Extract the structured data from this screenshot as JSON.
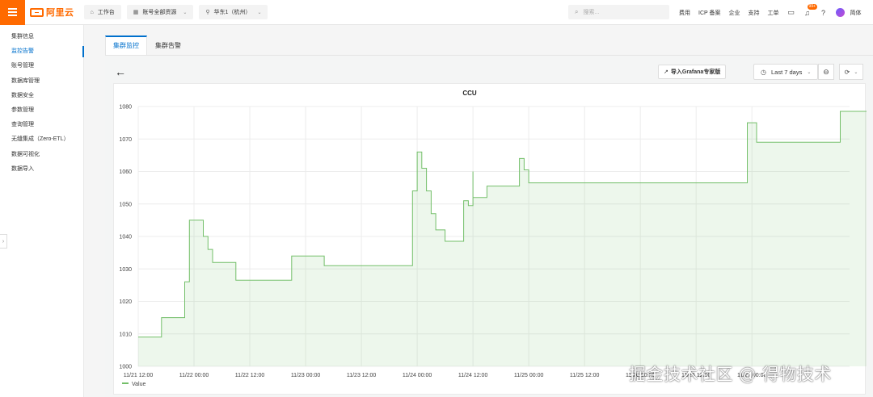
{
  "topbar": {
    "logo_text": "阿里云",
    "workbench": "工作台",
    "account": "账号全部资源",
    "region": "华东1（杭州）",
    "search_placeholder": "搜索...",
    "nav": [
      "费用",
      "ICP 备案",
      "企业",
      "支持",
      "工单"
    ],
    "badge": "99+",
    "lang": "简体",
    "accent_color": "#ff6a00"
  },
  "sidebar": {
    "items": [
      {
        "label": "集群信息"
      },
      {
        "label": "监控告警"
      },
      {
        "label": "账号管理"
      },
      {
        "label": "数据库管理"
      },
      {
        "label": "数据安全"
      },
      {
        "label": "参数管理"
      },
      {
        "label": "查询管理"
      },
      {
        "label": "无缝集成（Zero-ETL）"
      },
      {
        "label": "数据可视化"
      },
      {
        "label": "数据导入"
      }
    ],
    "active_index": 1
  },
  "tabs": [
    {
      "label": "集群监控",
      "active": true
    },
    {
      "label": "集群告警",
      "active": false
    }
  ],
  "toolbar": {
    "grafana_label": "导入Grafana专家版",
    "time_range": "Last 7 days"
  },
  "chart_data": {
    "type": "area",
    "title": "CCU",
    "xlabel": "",
    "ylabel": "",
    "ylim": [
      1000,
      1080
    ],
    "yticks": [
      1000,
      1010,
      1020,
      1030,
      1040,
      1050,
      1060,
      1070,
      1080
    ],
    "x_range": [
      "2024-11-21 12:00",
      "2024-11-27 21:00"
    ],
    "xticks": [
      "11/21 12:00",
      "11/22 00:00",
      "11/22 12:00",
      "11/23 00:00",
      "11/23 12:00",
      "11/24 00:00",
      "11/24 12:00",
      "11/25 00:00",
      "11/25 12:00",
      "11/26 00:00",
      "11/26 12:00",
      "11/27 00:00"
    ],
    "grid": true,
    "legend": "bottom-left",
    "color": "#73bf69",
    "series": [
      {
        "name": "Value",
        "points": [
          [
            "11/21 12:00",
            1009
          ],
          [
            "11/21 17:00",
            1009
          ],
          [
            "11/21 17:00",
            1015
          ],
          [
            "11/21 22:00",
            1015
          ],
          [
            "11/21 22:00",
            1026
          ],
          [
            "11/21 23:00",
            1026
          ],
          [
            "11/21 23:00",
            1045
          ],
          [
            "11/22 02:00",
            1045
          ],
          [
            "11/22 02:00",
            1040
          ],
          [
            "11/22 03:00",
            1040
          ],
          [
            "11/22 03:00",
            1036
          ],
          [
            "11/22 04:00",
            1036
          ],
          [
            "11/22 04:00",
            1032
          ],
          [
            "11/22 09:00",
            1032
          ],
          [
            "11/22 09:00",
            1026.5
          ],
          [
            "11/22 21:00",
            1026.5
          ],
          [
            "11/22 21:00",
            1034
          ],
          [
            "11/23 04:00",
            1034
          ],
          [
            "11/23 04:00",
            1031
          ],
          [
            "11/23 23:00",
            1031
          ],
          [
            "11/23 23:00",
            1054
          ],
          [
            "11/24 00:00",
            1054
          ],
          [
            "11/24 00:00",
            1066
          ],
          [
            "11/24 01:00",
            1066
          ],
          [
            "11/24 01:00",
            1061
          ],
          [
            "11/24 02:00",
            1061
          ],
          [
            "11/24 02:00",
            1054
          ],
          [
            "11/24 03:00",
            1054
          ],
          [
            "11/24 03:00",
            1047
          ],
          [
            "11/24 04:00",
            1047
          ],
          [
            "11/24 04:00",
            1042
          ],
          [
            "11/24 06:00",
            1042
          ],
          [
            "11/24 06:00",
            1038.5
          ],
          [
            "11/24 10:00",
            1038.5
          ],
          [
            "11/24 10:00",
            1051
          ],
          [
            "11/24 11:00",
            1051
          ],
          [
            "11/24 11:00",
            1049.5
          ],
          [
            "11/24 12:00",
            1049.5
          ],
          [
            "11/24 12:00",
            1060
          ],
          [
            "11/24 12:00",
            1052
          ],
          [
            "11/24 15:00",
            1052
          ],
          [
            "11/24 15:00",
            1055.5
          ],
          [
            "11/24 22:00",
            1055.5
          ],
          [
            "11/24 22:00",
            1064
          ],
          [
            "11/24 23:00",
            1064
          ],
          [
            "11/24 23:00",
            1060.5
          ],
          [
            "11/25 00:00",
            1060.5
          ],
          [
            "11/25 00:00",
            1056.5
          ],
          [
            "11/26 23:00",
            1056.5
          ],
          [
            "11/26 23:00",
            1075
          ],
          [
            "11/27 01:00",
            1075
          ],
          [
            "11/27 01:00",
            1069
          ],
          [
            "11/27 19:00",
            1069
          ],
          [
            "11/27 19:00",
            1078.5
          ],
          [
            "11/28 01:00",
            1078.5
          ],
          [
            "11/28 01:00",
            1074
          ],
          [
            "11/28 03:00",
            1074
          ],
          [
            "11/28 03:00",
            1068.5
          ],
          [
            "11/28 07:00",
            1068.5
          ]
        ]
      }
    ]
  },
  "watermark": "掘金技术社区 @ 得物技术"
}
